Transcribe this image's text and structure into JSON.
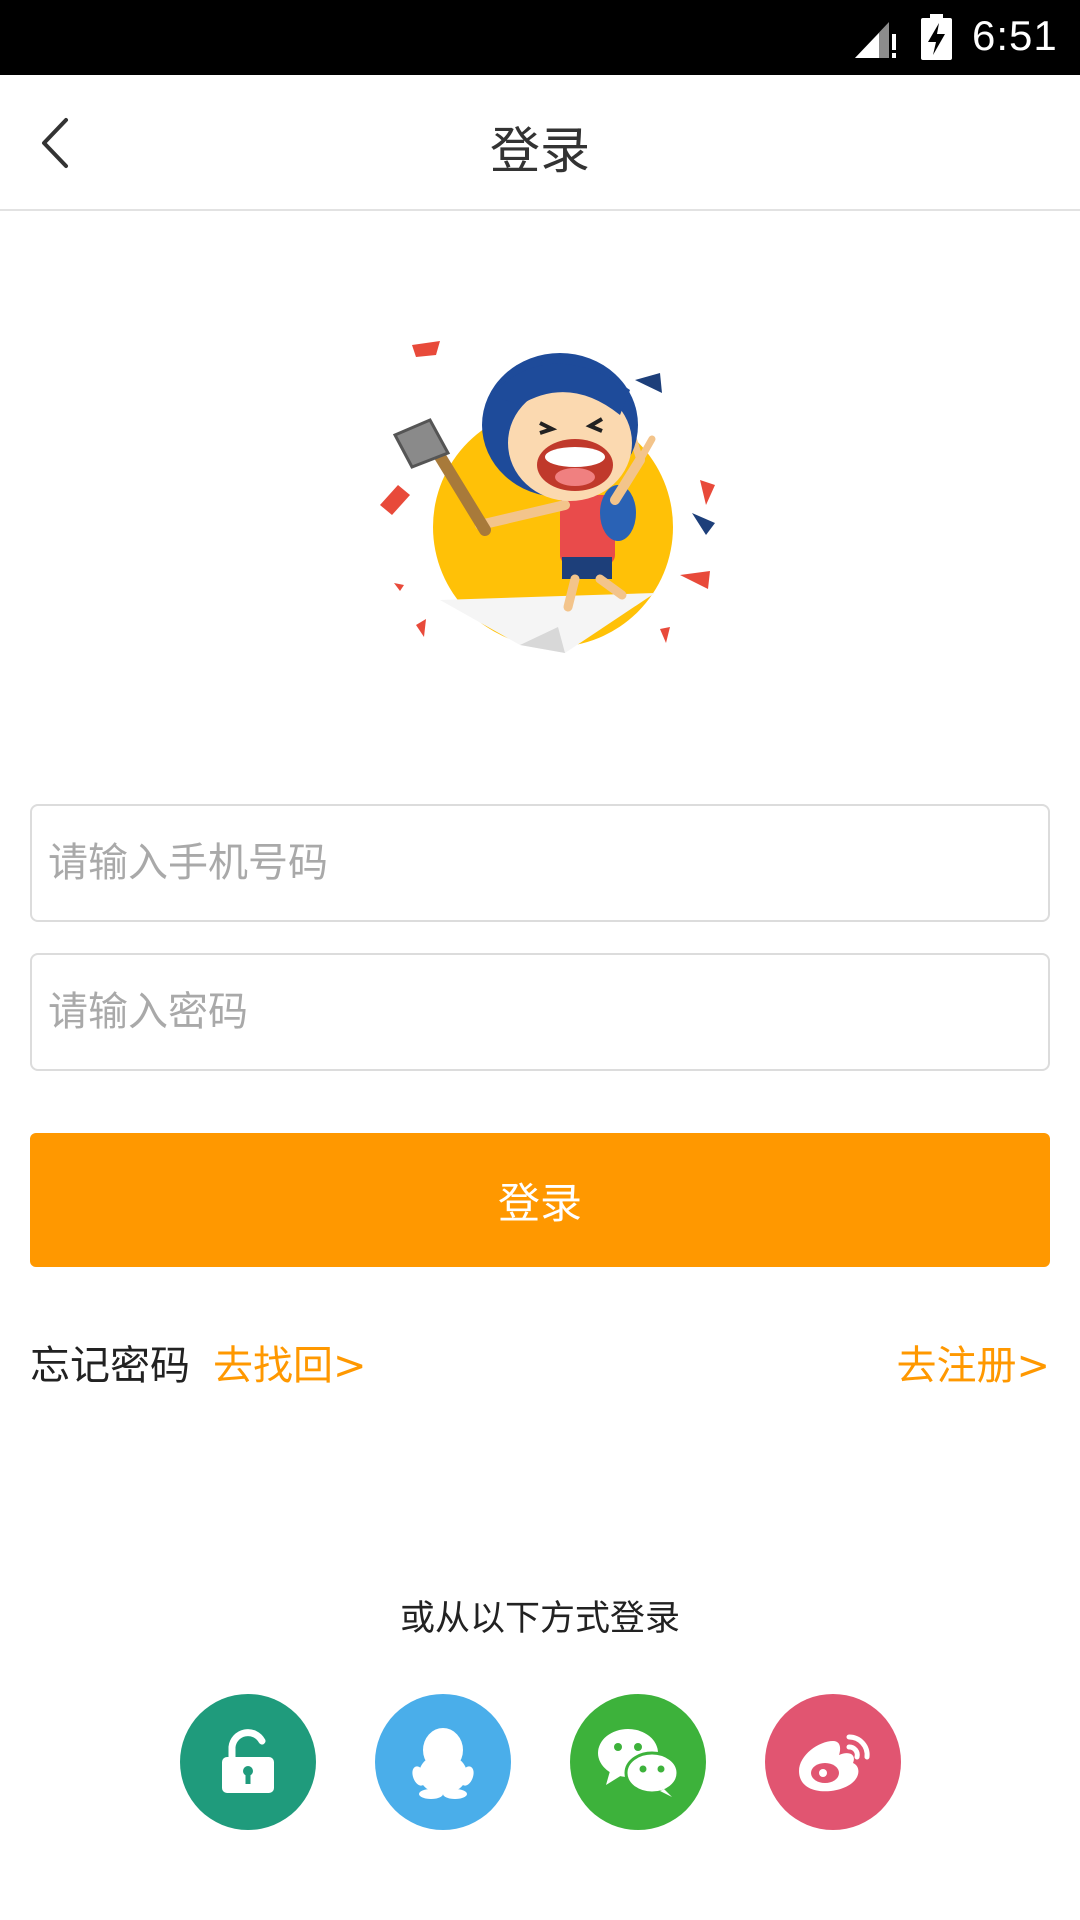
{
  "status_bar": {
    "time": "6:51",
    "icons": [
      "signal-icon",
      "battery-charging-icon"
    ]
  },
  "app_bar": {
    "title": "登录",
    "back_icon": "chevron-left-icon"
  },
  "illustration": {
    "name": "mascot-illustration"
  },
  "form": {
    "phone_placeholder": "请输入手机号码",
    "phone_value": "",
    "password_placeholder": "请输入密码",
    "password_value": "",
    "login_label": "登录"
  },
  "links": {
    "forgot_label": "忘记密码",
    "recover_label": "去找回>",
    "register_label": "去注册>"
  },
  "other_login": {
    "label": "或从以下方式登录",
    "methods": [
      {
        "icon": "unlock-icon",
        "color": "#1f9b7c"
      },
      {
        "icon": "qq-icon",
        "color": "#4aaeea"
      },
      {
        "icon": "wechat-icon",
        "color": "#3db23b"
      },
      {
        "icon": "weibo-icon",
        "color": "#e15571"
      }
    ]
  },
  "colors": {
    "accent": "#ff9800",
    "status_bar": "#000000"
  }
}
